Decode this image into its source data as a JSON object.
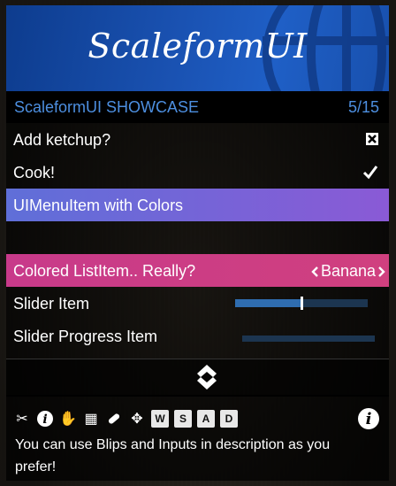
{
  "banner": {
    "title": "ScaleformUI",
    "color_start": "#0d3c8e",
    "color_end": "#1f5fc6"
  },
  "subtitle": {
    "text": "ScaleformUI SHOWCASE",
    "counter": "5/15",
    "color": "#4d8fe0"
  },
  "items": [
    {
      "label": "Add ketchup?",
      "type": "checkbox",
      "checked": true,
      "icon": "cross-check-icon"
    },
    {
      "label": "Cook!",
      "type": "tick",
      "icon": "checkmark-icon"
    },
    {
      "label": "UIMenuItem with Colors",
      "type": "colored",
      "colors": [
        "#5f6fd8",
        "#8a5ad6"
      ]
    },
    {
      "label": "",
      "type": "spacer"
    },
    {
      "label": "Colored ListItem.. Really?",
      "type": "list",
      "value": "Banana",
      "colors": [
        "#c83a8a",
        "#d0407f"
      ]
    },
    {
      "label": "Slider Item",
      "type": "slider",
      "value": 0.5
    },
    {
      "label": "Slider Progress Item",
      "type": "progress",
      "value": 0.0
    }
  ],
  "scroll": {
    "icon": "scroll-arrows-icon"
  },
  "description": {
    "icons": [
      "scissors-icon",
      "info-icon",
      "hand-icon",
      "building-icon",
      "pill-icon",
      "move-icon"
    ],
    "keys": [
      "W",
      "S",
      "A",
      "D"
    ],
    "info_icon": "info-icon",
    "text": "You can use Blips and Inputs in description as you prefer!"
  }
}
